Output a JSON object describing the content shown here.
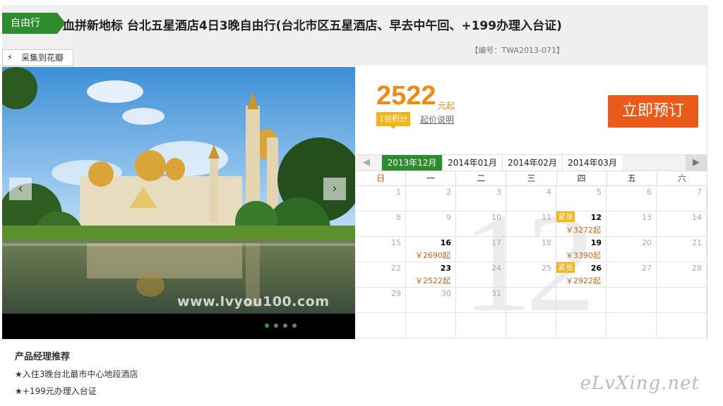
{
  "header": {
    "tag": "自由行",
    "title": "血拼新地标 台北五星酒店4日3晚自由行(台北市区五星酒店、早去中午回、+199办理入台证)",
    "code": "【编号：TWA2013-071】"
  },
  "pin_button": {
    "label": "采集到花瓣",
    "icon": "bolt-icon"
  },
  "gallery": {
    "watermark": "www.lvyou100.com",
    "slide_count": 4,
    "active_slide": 1,
    "prev_icon": "chevron-left-icon",
    "next_icon": "chevron-right-icon"
  },
  "pricing": {
    "price": "2522",
    "unit": "元起",
    "points": "1倍积分",
    "note": "起价说明",
    "book": "立即预订"
  },
  "calendar": {
    "months": [
      "2013年12月",
      "2014年01月",
      "2014年02月",
      "2014年03月"
    ],
    "active_month": 0,
    "weekdays": [
      "日",
      "一",
      "二",
      "三",
      "四",
      "五",
      "六"
    ],
    "big_month": "12",
    "weeks": [
      [
        {
          "d": "1"
        },
        {
          "d": "2"
        },
        {
          "d": "3"
        },
        {
          "d": "4"
        },
        {
          "d": "5"
        },
        {
          "d": "6"
        },
        {
          "d": "7"
        }
      ],
      [
        {
          "d": "8"
        },
        {
          "d": "9"
        },
        {
          "d": "10"
        },
        {
          "d": "11"
        },
        {
          "d": "12",
          "price": "￥3272起",
          "tag": "紧张"
        },
        {
          "d": "13"
        },
        {
          "d": "14"
        }
      ],
      [
        {
          "d": "15"
        },
        {
          "d": "16",
          "price": "￥2690起"
        },
        {
          "d": "17"
        },
        {
          "d": "18"
        },
        {
          "d": "19",
          "price": "￥3390起"
        },
        {
          "d": "20"
        },
        {
          "d": "21"
        }
      ],
      [
        {
          "d": "22"
        },
        {
          "d": "23",
          "price": "￥2522起"
        },
        {
          "d": "24"
        },
        {
          "d": "25"
        },
        {
          "d": "26",
          "price": "￥2922起",
          "tag": "紧张"
        },
        {
          "d": "27"
        },
        {
          "d": "28"
        }
      ],
      [
        {
          "d": "29"
        },
        {
          "d": "30"
        },
        {
          "d": "31"
        },
        {
          "d": ""
        },
        {
          "d": ""
        },
        {
          "d": ""
        },
        {
          "d": ""
        }
      ],
      [
        {
          "d": ""
        },
        {
          "d": ""
        },
        {
          "d": ""
        },
        {
          "d": ""
        },
        {
          "d": ""
        },
        {
          "d": ""
        },
        {
          "d": ""
        }
      ]
    ]
  },
  "recommendation": {
    "title": "产品经理推荐",
    "items": [
      "★入住3晚台北最市中心地段酒店",
      "★+199元办理入台证"
    ]
  },
  "site_mark": "eLvXing.net",
  "colors": {
    "brand_green": "#2e8b2e",
    "price_orange": "#f08a16",
    "book_orange": "#ea5a18",
    "tight_yellow": "#f6b318"
  }
}
